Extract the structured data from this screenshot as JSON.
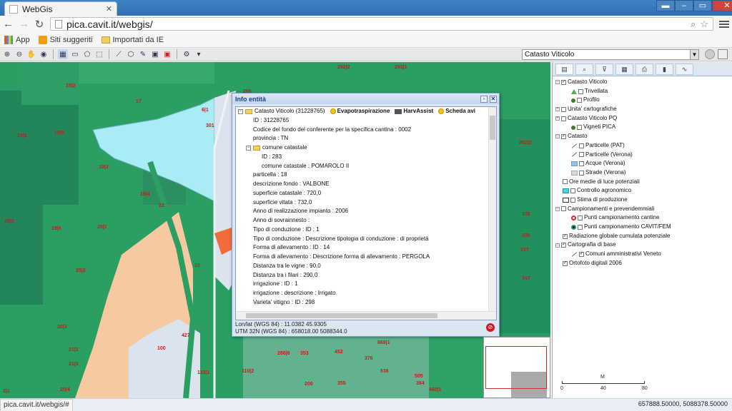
{
  "browser": {
    "tab_title": "WebGis",
    "url": "pica.cavit.it/webgis/",
    "bookmarks": [
      {
        "label": "App",
        "icon": "apps-grid-icon"
      },
      {
        "label": "Siti suggeriti",
        "icon": "suggested-sites-icon"
      },
      {
        "label": "Importati da IE",
        "icon": "folder-icon"
      }
    ]
  },
  "toolbar": {
    "layer_select_value": "Catasto Viticolo"
  },
  "info_window": {
    "title": "Info entità",
    "root_label": "Catasto Viticolo (31228765)",
    "action_buttons": [
      "Evapotraspirazione",
      "HarvAssist",
      "Scheda avi"
    ],
    "attributes_top": [
      "ID  :  31228765",
      "Codice del fondo del conferente per la specifica cantina  :  0002",
      "provincia  :  TN"
    ],
    "comune_group_label": "comune catastale",
    "comune_attributes": [
      "ID  :  283",
      "comune catastale  :  POMAROLO II"
    ],
    "attributes_bottom": [
      "particella  :  18",
      "descrizione fondo  :  VALBONE",
      "superficie catastale  :  720,0",
      "superficie vitata  :  732,0",
      "Anno di realizzazione impianto  :  2006",
      "Anno di sovrainnesto  :",
      "Tipo di conduzione : ID  :  1",
      "Tipo di conduzione : Descrizione tipologia di conduzione  :  di proprietà",
      "Forma di allevamento : ID  :  14",
      "Forma di allevamento : Descrizione forma di allevamento  :  PERGOLA",
      "Distanza tra le vigne  :  90,0",
      "Distanza tra i filari  :  290,0",
      "irrigazione : ID  :  1",
      "irrigazione : descrizione  :  Irrigato",
      "Varieta' vitigno : ID  :  298"
    ],
    "footer_lonlat": "Lon/lat (WGS 84) : 11.0382 45.9305",
    "footer_utm": "UTM 32N (WGS 84) : 658018.00 5088344.0"
  },
  "map": {
    "parcel_labels": [
      {
        "t": "15|2"
      },
      {
        "t": "17"
      },
      {
        "t": "6|1"
      },
      {
        "t": "301"
      },
      {
        "t": "19|1"
      },
      {
        "t": "19|5"
      },
      {
        "t": "19|3"
      },
      {
        "t": "19|4"
      },
      {
        "t": "22"
      },
      {
        "t": "19|2"
      },
      {
        "t": "19|6"
      },
      {
        "t": "20|1"
      },
      {
        "t": "20|2"
      },
      {
        "t": "23"
      },
      {
        "t": "20|3"
      },
      {
        "t": "427"
      },
      {
        "t": "100"
      },
      {
        "t": "110|1"
      },
      {
        "t": "110|2"
      },
      {
        "t": "21|2"
      },
      {
        "t": "21|3"
      },
      {
        "t": "20|4"
      },
      {
        "t": "2|1"
      },
      {
        "t": "292|2"
      },
      {
        "t": "293|1"
      },
      {
        "t": "295"
      },
      {
        "t": "286|6"
      },
      {
        "t": "353"
      },
      {
        "t": "452"
      },
      {
        "t": "376"
      },
      {
        "t": "209"
      },
      {
        "t": "355"
      },
      {
        "t": "536"
      },
      {
        "t": "505"
      },
      {
        "t": "384"
      },
      {
        "t": "460|1"
      },
      {
        "t": "262|2"
      },
      {
        "t": "338"
      },
      {
        "t": "335"
      },
      {
        "t": "337"
      },
      {
        "t": "347"
      },
      {
        "t": "869|1"
      }
    ]
  },
  "panel": {
    "tabs": [
      "layers",
      "search",
      "filter",
      "table",
      "print",
      "chart",
      "graph"
    ],
    "layers": [
      {
        "label": "Catasto Viticolo",
        "level": 0,
        "pm": "-",
        "checked": true,
        "sym": "none"
      },
      {
        "label": "Trivellata",
        "level": 1,
        "pm": "",
        "checked": false,
        "sym": "triangle"
      },
      {
        "label": "Profilo",
        "level": 1,
        "pm": "",
        "checked": false,
        "sym": "dot"
      },
      {
        "label": "Unita' cartografiche",
        "level": 0,
        "pm": "+",
        "checked": false,
        "sym": "none"
      },
      {
        "label": "Catasto Viticolo PQ",
        "level": 0,
        "pm": "+",
        "checked": false,
        "sym": "none"
      },
      {
        "label": "Vigneti PICA",
        "level": 1,
        "pm": "",
        "checked": false,
        "sym": "dot"
      },
      {
        "label": "Catasto",
        "level": 0,
        "pm": "-",
        "checked": true,
        "sym": "none"
      },
      {
        "label": "Particelle (PAT)",
        "level": 1,
        "pm": "",
        "checked": false,
        "sym": "line"
      },
      {
        "label": "Particelle (Verona)",
        "level": 1,
        "pm": "",
        "checked": false,
        "sym": "line"
      },
      {
        "label": "Acque (Verona)",
        "level": 1,
        "pm": "",
        "checked": false,
        "sym": "water"
      },
      {
        "label": "Strade (Verona)",
        "level": 1,
        "pm": "",
        "checked": false,
        "sym": "road"
      },
      {
        "label": "Ore medie di luce potenziali",
        "level": 0,
        "pm": "",
        "checked": false,
        "sym": "none"
      },
      {
        "label": "Controllo agronomico",
        "level": 0,
        "pm": "",
        "checked": false,
        "sym": "cyan"
      },
      {
        "label": "Stima di produzione",
        "level": 0,
        "pm": "",
        "checked": false,
        "sym": "box"
      },
      {
        "label": "Campionamenti e prevendemmiali",
        "level": 0,
        "pm": "-",
        "checked": false,
        "sym": "none"
      },
      {
        "label": "Punti campionamento cantine",
        "level": 1,
        "pm": "",
        "checked": false,
        "sym": "redcircle"
      },
      {
        "label": "Punti campionamento CAVIT/FEM",
        "level": 1,
        "pm": "",
        "checked": false,
        "sym": "greencircle"
      },
      {
        "label": "Radiazione globale cumulata potenziale",
        "level": 0,
        "pm": "",
        "checked": true,
        "sym": "none"
      },
      {
        "label": "Cartografia di base",
        "level": 0,
        "pm": "-",
        "checked": true,
        "sym": "none"
      },
      {
        "label": "Comuni amministrativi Veneto",
        "level": 1,
        "pm": "",
        "checked": true,
        "sym": "line"
      },
      {
        "label": "Ortofoto digitali 2006",
        "level": 0,
        "pm": "",
        "checked": true,
        "sym": "none"
      }
    ],
    "scale_unit": "M",
    "scale_ticks": [
      "0",
      "40",
      "80"
    ]
  },
  "status": {
    "url_hint": "pica.cavit.it/webgis/#",
    "coords": "657888.50000, 5088378.50000"
  },
  "colors": {
    "map_green": "#2a9e63",
    "map_dark_green": "#23855a",
    "peach": "#f6c9a0",
    "light_blue": "#a8ecf6",
    "parcel_red": "#d4151b"
  }
}
